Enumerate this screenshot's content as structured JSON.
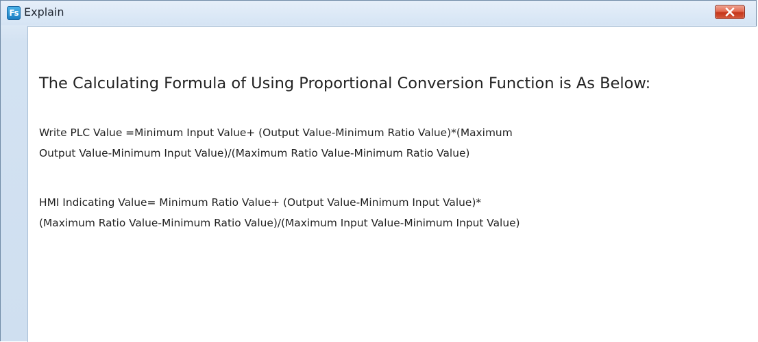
{
  "window": {
    "title": "Explain",
    "app_icon_text": "Fs",
    "app_icon": "fs-app-icon",
    "close_icon": "close-icon"
  },
  "content": {
    "heading": "The Calculating Formula of Using Proportional Conversion Function is As Below:",
    "formula_write_plc": {
      "line1": "Write PLC Value =Minimum Input Value+ (Output Value-Minimum Ratio Value)*(Maximum",
      "line2": "Output Value-Minimum Input Value)/(Maximum Ratio Value-Minimum Ratio Value)"
    },
    "formula_hmi": {
      "line1": "HMI Indicating Value= Minimum Ratio Value+ (Output Value-Minimum Input Value)*",
      "line2": "(Maximum Ratio Value-Minimum Ratio Value)/(Maximum Input Value-Minimum Input Value)"
    }
  },
  "colors": {
    "close_button": "#c5361a",
    "titlebar": "#d5e4f4",
    "text": "#222222"
  }
}
